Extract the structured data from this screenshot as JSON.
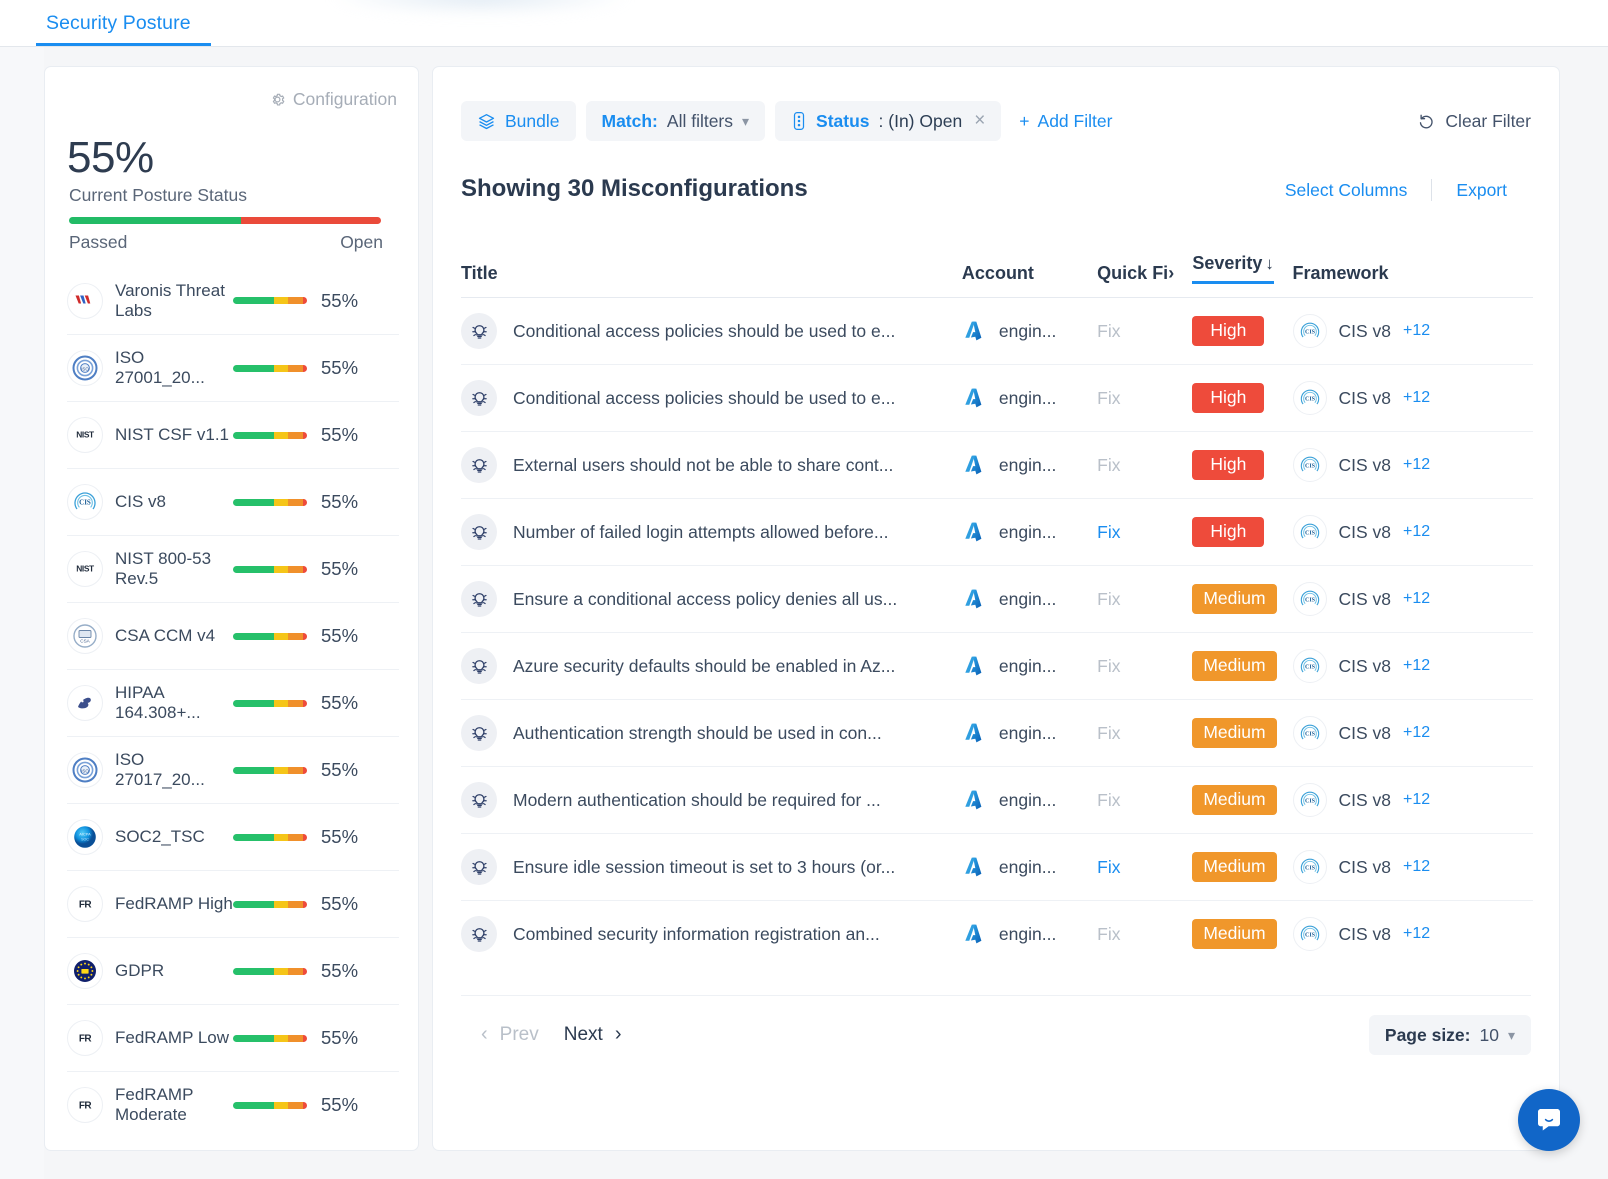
{
  "tab": {
    "label": "Security Posture"
  },
  "sidebar": {
    "config_label": "Configuration",
    "score": "55%",
    "score_caption": "Current Posture Status",
    "bar_left_label": "Passed",
    "bar_right_label": "Open",
    "passed_ratio": 55,
    "frameworks": [
      {
        "name": "Varonis Threat Labs",
        "pct": "55%",
        "icon": "varonis-icon"
      },
      {
        "name": "ISO 27001_20...",
        "pct": "55%",
        "icon": "iso-icon"
      },
      {
        "name": "NIST CSF v1.1",
        "pct": "55%",
        "icon": "nist-icon"
      },
      {
        "name": "CIS v8",
        "pct": "55%",
        "icon": "cis-icon"
      },
      {
        "name": "NIST 800-53 Rev.5",
        "pct": "55%",
        "icon": "nist-icon"
      },
      {
        "name": "CSA CCM v4",
        "pct": "55%",
        "icon": "csa-icon"
      },
      {
        "name": "HIPAA 164.308+...",
        "pct": "55%",
        "icon": "hipaa-icon"
      },
      {
        "name": "ISO 27017_20...",
        "pct": "55%",
        "icon": "iso-icon"
      },
      {
        "name": "SOC2_TSC",
        "pct": "55%",
        "icon": "soc2-icon"
      },
      {
        "name": "FedRAMP High",
        "pct": "55%",
        "icon": "fedramp-icon"
      },
      {
        "name": "GDPR",
        "pct": "55%",
        "icon": "gdpr-icon"
      },
      {
        "name": "FedRAMP Low",
        "pct": "55%",
        "icon": "fedramp-icon"
      },
      {
        "name": "FedRAMP Moderate",
        "pct": "55%",
        "icon": "fedramp-icon"
      }
    ]
  },
  "toolbar": {
    "bundle_label": "Bundle",
    "match_key": "Match:",
    "match_value": "All filters",
    "status_key": "Status",
    "status_value": ": (In) Open",
    "add_filter_label": "Add Filter",
    "clear_filter_label": "Clear Filter"
  },
  "main": {
    "showing": "Showing 30 Misconfigurations",
    "select_columns": "Select Columns",
    "export": "Export",
    "columns": {
      "title": "Title",
      "account": "Account",
      "quick_fix": "Quick Fi›",
      "severity": "Severity",
      "sort_arrow": "↓",
      "framework": "Framework"
    },
    "rows": [
      {
        "title": "Conditional access policies should be used to e...",
        "account": "engin...",
        "quick_fix": "Fix",
        "quick_fix_active": false,
        "severity": "High",
        "framework": "CIS v8",
        "more": "+12"
      },
      {
        "title": "Conditional access policies should be used to e...",
        "account": "engin...",
        "quick_fix": "Fix",
        "quick_fix_active": false,
        "severity": "High",
        "framework": "CIS v8",
        "more": "+12"
      },
      {
        "title": "External users should not be able to share cont...",
        "account": "engin...",
        "quick_fix": "Fix",
        "quick_fix_active": false,
        "severity": "High",
        "framework": "CIS v8",
        "more": "+12"
      },
      {
        "title": "Number of failed login attempts allowed before...",
        "account": "engin...",
        "quick_fix": "Fix",
        "quick_fix_active": true,
        "severity": "High",
        "framework": "CIS v8",
        "more": "+12"
      },
      {
        "title": "Ensure a conditional access policy denies all us...",
        "account": "engin...",
        "quick_fix": "Fix",
        "quick_fix_active": false,
        "severity": "Medium",
        "framework": "CIS v8",
        "more": "+12"
      },
      {
        "title": "Azure security defaults should be enabled in Az...",
        "account": "engin...",
        "quick_fix": "Fix",
        "quick_fix_active": false,
        "severity": "Medium",
        "framework": "CIS v8",
        "more": "+12"
      },
      {
        "title": "Authentication strength should be used in con...",
        "account": "engin...",
        "quick_fix": "Fix",
        "quick_fix_active": false,
        "severity": "Medium",
        "framework": "CIS v8",
        "more": "+12"
      },
      {
        "title": "Modern authentication should be required for ...",
        "account": "engin...",
        "quick_fix": "Fix",
        "quick_fix_active": false,
        "severity": "Medium",
        "framework": "CIS v8",
        "more": "+12"
      },
      {
        "title": "Ensure idle session timeout is set to 3 hours (or...",
        "account": "engin...",
        "quick_fix": "Fix",
        "quick_fix_active": true,
        "severity": "Medium",
        "framework": "CIS v8",
        "more": "+12"
      },
      {
        "title": "Combined security information registration an...",
        "account": "engin...",
        "quick_fix": "Fix",
        "quick_fix_active": false,
        "severity": "Medium",
        "framework": "CIS v8",
        "more": "+12"
      }
    ]
  },
  "pagination": {
    "prev_label": "Prev",
    "next_label": "Next",
    "page_size_label": "Page size:",
    "page_size_value": "10"
  },
  "colors": {
    "accent_blue": "#1a8df0",
    "high": "#ee4b3b",
    "medium": "#f0972b",
    "passed_green": "#22bb66",
    "open_red": "#ea4a3a",
    "chat_blue": "#1166c8"
  }
}
